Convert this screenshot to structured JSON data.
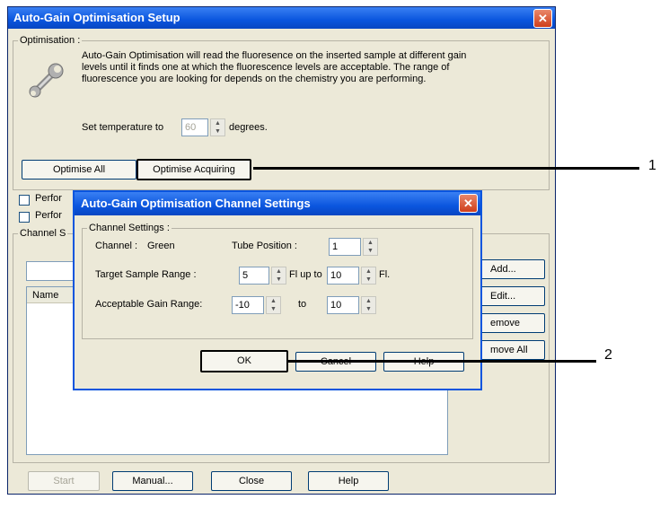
{
  "window": {
    "title": "Auto-Gain Optimisation Setup",
    "close_glyph": "✕",
    "optimisation": {
      "group_label": "Optimisation :",
      "description": "Auto-Gain Optimisation will read the fluoresence on the inserted sample at different gain levels until it finds one at which the fluorescence levels are acceptable. The range of fluorescence you are looking for depends on the chemistry you are performing.",
      "temp_prefix": "Set temperature to",
      "temp_value": "60",
      "temp_suffix": "degrees.",
      "optimise_all": "Optimise All",
      "optimise_acquiring": "Optimise Acquiring",
      "perform1": "Perfor",
      "perform2": "Perfor"
    },
    "channel_group_label": "Channel S",
    "list_header": "Name",
    "side_buttons": [
      "Add...",
      "Edit...",
      "emove",
      "move All"
    ],
    "bottom_buttons": [
      "Start",
      "Manual...",
      "Close",
      "Help"
    ]
  },
  "dialog": {
    "title": "Auto-Gain Optimisation Channel Settings",
    "close_glyph": "✕",
    "group_label": "Channel Settings :",
    "channel_label": "Channel :",
    "channel_value": "Green",
    "tube_position_label": "Tube Position :",
    "tube_position_value": "1",
    "target_label": "Target Sample Range :",
    "target_from": "5",
    "fl_up_to": "Fl up to",
    "target_to": "10",
    "fl": "Fl.",
    "gain_label": "Acceptable Gain Range:",
    "gain_from": "-10",
    "to": "to",
    "gain_to": "10",
    "ok": "OK",
    "cancel": "Cancel",
    "help": "Help"
  },
  "callouts": [
    "1",
    "2"
  ]
}
